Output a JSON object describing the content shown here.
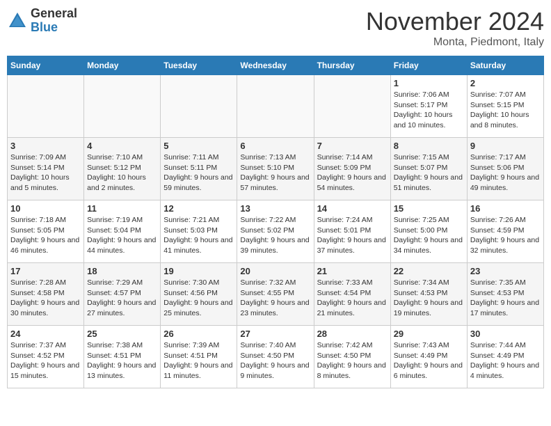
{
  "header": {
    "logo_line1": "General",
    "logo_line2": "Blue",
    "month_title": "November 2024",
    "location": "Monta, Piedmont, Italy"
  },
  "weekdays": [
    "Sunday",
    "Monday",
    "Tuesday",
    "Wednesday",
    "Thursday",
    "Friday",
    "Saturday"
  ],
  "weeks": [
    [
      {
        "day": "",
        "info": ""
      },
      {
        "day": "",
        "info": ""
      },
      {
        "day": "",
        "info": ""
      },
      {
        "day": "",
        "info": ""
      },
      {
        "day": "",
        "info": ""
      },
      {
        "day": "1",
        "info": "Sunrise: 7:06 AM\nSunset: 5:17 PM\nDaylight: 10 hours and 10 minutes."
      },
      {
        "day": "2",
        "info": "Sunrise: 7:07 AM\nSunset: 5:15 PM\nDaylight: 10 hours and 8 minutes."
      }
    ],
    [
      {
        "day": "3",
        "info": "Sunrise: 7:09 AM\nSunset: 5:14 PM\nDaylight: 10 hours and 5 minutes."
      },
      {
        "day": "4",
        "info": "Sunrise: 7:10 AM\nSunset: 5:12 PM\nDaylight: 10 hours and 2 minutes."
      },
      {
        "day": "5",
        "info": "Sunrise: 7:11 AM\nSunset: 5:11 PM\nDaylight: 9 hours and 59 minutes."
      },
      {
        "day": "6",
        "info": "Sunrise: 7:13 AM\nSunset: 5:10 PM\nDaylight: 9 hours and 57 minutes."
      },
      {
        "day": "7",
        "info": "Sunrise: 7:14 AM\nSunset: 5:09 PM\nDaylight: 9 hours and 54 minutes."
      },
      {
        "day": "8",
        "info": "Sunrise: 7:15 AM\nSunset: 5:07 PM\nDaylight: 9 hours and 51 minutes."
      },
      {
        "day": "9",
        "info": "Sunrise: 7:17 AM\nSunset: 5:06 PM\nDaylight: 9 hours and 49 minutes."
      }
    ],
    [
      {
        "day": "10",
        "info": "Sunrise: 7:18 AM\nSunset: 5:05 PM\nDaylight: 9 hours and 46 minutes."
      },
      {
        "day": "11",
        "info": "Sunrise: 7:19 AM\nSunset: 5:04 PM\nDaylight: 9 hours and 44 minutes."
      },
      {
        "day": "12",
        "info": "Sunrise: 7:21 AM\nSunset: 5:03 PM\nDaylight: 9 hours and 41 minutes."
      },
      {
        "day": "13",
        "info": "Sunrise: 7:22 AM\nSunset: 5:02 PM\nDaylight: 9 hours and 39 minutes."
      },
      {
        "day": "14",
        "info": "Sunrise: 7:24 AM\nSunset: 5:01 PM\nDaylight: 9 hours and 37 minutes."
      },
      {
        "day": "15",
        "info": "Sunrise: 7:25 AM\nSunset: 5:00 PM\nDaylight: 9 hours and 34 minutes."
      },
      {
        "day": "16",
        "info": "Sunrise: 7:26 AM\nSunset: 4:59 PM\nDaylight: 9 hours and 32 minutes."
      }
    ],
    [
      {
        "day": "17",
        "info": "Sunrise: 7:28 AM\nSunset: 4:58 PM\nDaylight: 9 hours and 30 minutes."
      },
      {
        "day": "18",
        "info": "Sunrise: 7:29 AM\nSunset: 4:57 PM\nDaylight: 9 hours and 27 minutes."
      },
      {
        "day": "19",
        "info": "Sunrise: 7:30 AM\nSunset: 4:56 PM\nDaylight: 9 hours and 25 minutes."
      },
      {
        "day": "20",
        "info": "Sunrise: 7:32 AM\nSunset: 4:55 PM\nDaylight: 9 hours and 23 minutes."
      },
      {
        "day": "21",
        "info": "Sunrise: 7:33 AM\nSunset: 4:54 PM\nDaylight: 9 hours and 21 minutes."
      },
      {
        "day": "22",
        "info": "Sunrise: 7:34 AM\nSunset: 4:53 PM\nDaylight: 9 hours and 19 minutes."
      },
      {
        "day": "23",
        "info": "Sunrise: 7:35 AM\nSunset: 4:53 PM\nDaylight: 9 hours and 17 minutes."
      }
    ],
    [
      {
        "day": "24",
        "info": "Sunrise: 7:37 AM\nSunset: 4:52 PM\nDaylight: 9 hours and 15 minutes."
      },
      {
        "day": "25",
        "info": "Sunrise: 7:38 AM\nSunset: 4:51 PM\nDaylight: 9 hours and 13 minutes."
      },
      {
        "day": "26",
        "info": "Sunrise: 7:39 AM\nSunset: 4:51 PM\nDaylight: 9 hours and 11 minutes."
      },
      {
        "day": "27",
        "info": "Sunrise: 7:40 AM\nSunset: 4:50 PM\nDaylight: 9 hours and 9 minutes."
      },
      {
        "day": "28",
        "info": "Sunrise: 7:42 AM\nSunset: 4:50 PM\nDaylight: 9 hours and 8 minutes."
      },
      {
        "day": "29",
        "info": "Sunrise: 7:43 AM\nSunset: 4:49 PM\nDaylight: 9 hours and 6 minutes."
      },
      {
        "day": "30",
        "info": "Sunrise: 7:44 AM\nSunset: 4:49 PM\nDaylight: 9 hours and 4 minutes."
      }
    ]
  ]
}
